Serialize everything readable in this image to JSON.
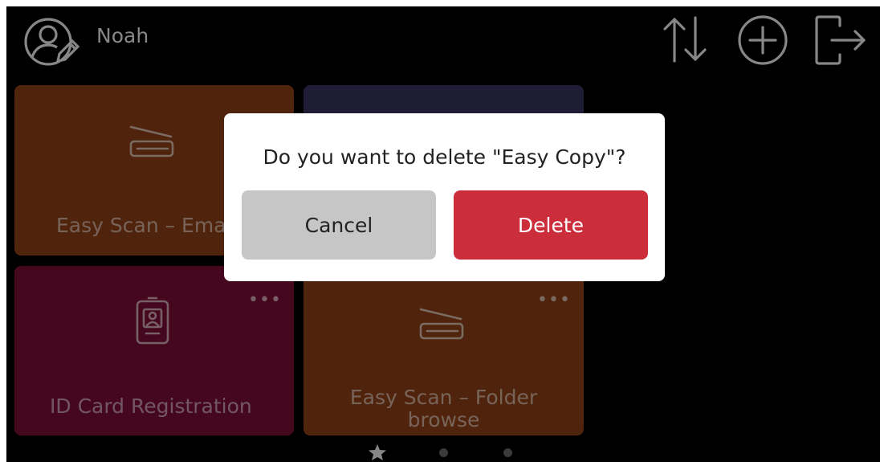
{
  "header": {
    "user_name": "Noah",
    "icons": [
      "user-edit-icon",
      "sort-icon",
      "add-circle-icon",
      "logout-icon"
    ]
  },
  "tiles": [
    {
      "label": "Easy Scan – Email",
      "icon": "scanner-icon",
      "color": "#7a3713"
    },
    {
      "label": "",
      "icon": "",
      "color": "#2f2d52"
    },
    {
      "label": "ID Card Registration",
      "icon": "id-card-icon",
      "color": "#690b2f"
    },
    {
      "label": "Easy Scan – Folder browse",
      "icon": "scanner-icon",
      "color": "#7a3713"
    }
  ],
  "tile_menu_glyph": "•••",
  "dialog": {
    "message": "Do you want to delete \"Easy Copy\"?",
    "cancel_label": "Cancel",
    "delete_label": "Delete",
    "delete_color": "#cc2d3b"
  },
  "pager": {
    "pages": [
      "favorites-star-icon",
      "page-dot",
      "page-dot"
    ],
    "active_index": 0
  }
}
